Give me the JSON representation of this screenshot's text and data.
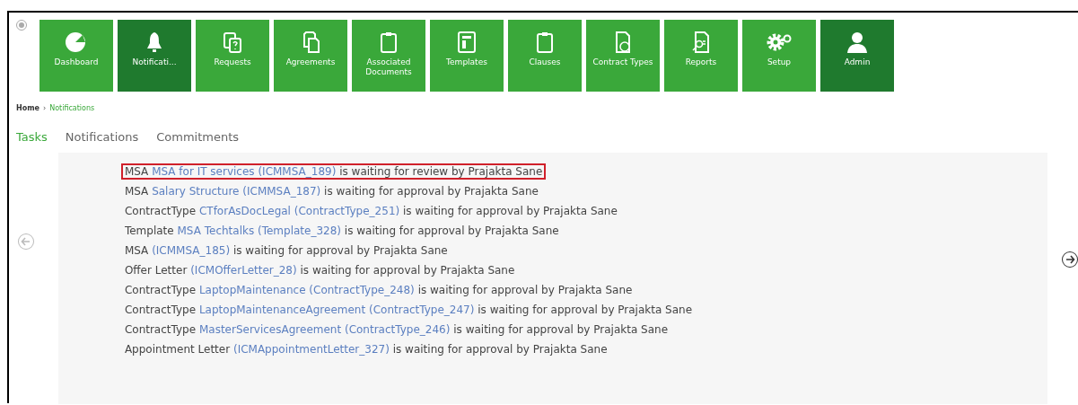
{
  "tiles": [
    {
      "label": "Dashboard",
      "kind": "module",
      "selected": false
    },
    {
      "label": "Notificati...",
      "kind": "module",
      "selected": true
    },
    {
      "label": "Requests",
      "kind": "module",
      "selected": false
    },
    {
      "label": "Agreements",
      "kind": "module",
      "selected": false
    },
    {
      "label": "Associated Documents",
      "kind": "module",
      "selected": false
    },
    {
      "label": "Templates",
      "kind": "module",
      "selected": false
    },
    {
      "label": "Clauses",
      "kind": "module",
      "selected": false
    },
    {
      "label": "Contract Types",
      "kind": "module",
      "selected": false
    },
    {
      "label": "Reports",
      "kind": "module",
      "selected": false
    },
    {
      "label": "Setup",
      "kind": "module",
      "selected": false
    },
    {
      "label": "Admin",
      "kind": "admin"
    }
  ],
  "breadcrumb": {
    "home": "Home",
    "separator": "›",
    "current": "Notifications"
  },
  "tabs": [
    {
      "label": "Tasks",
      "selected": true
    },
    {
      "label": "Notifications",
      "selected": false
    },
    {
      "label": "Commitments",
      "selected": false
    }
  ],
  "prev_arrow": {
    "disabled": true
  },
  "next_arrow": {
    "disabled": false
  },
  "tasks": [
    {
      "type": "MSA",
      "link": "MSA for IT services (ICMMSA_189)",
      "rest": "is waiting for review by Prajakta Sane",
      "highlighted": true
    },
    {
      "type": "MSA",
      "link": "Salary Structure (ICMMSA_187)",
      "rest": "is waiting for approval by Prajakta Sane",
      "highlighted": false
    },
    {
      "type": "ContractType",
      "link": "CTforAsDocLegal (ContractType_251)",
      "rest": "is waiting for approval by Prajakta Sane",
      "highlighted": false
    },
    {
      "type": "Template",
      "link": "MSA Techtalks (Template_328)",
      "rest": "is waiting for approval by Prajakta Sane",
      "highlighted": false
    },
    {
      "type": "MSA",
      "link": "(ICMMSA_185)",
      "rest": "is waiting for approval by Prajakta Sane",
      "highlighted": false
    },
    {
      "type": "Offer Letter",
      "link": "(ICMOfferLetter_28)",
      "rest": "is waiting for approval by Prajakta Sane",
      "highlighted": false
    },
    {
      "type": "ContractType",
      "link": "LaptopMaintenance (ContractType_248)",
      "rest": "is waiting for approval by Prajakta Sane",
      "highlighted": false
    },
    {
      "type": "ContractType",
      "link": "LaptopMaintenanceAgreement (ContractType_247)",
      "rest": "is waiting for approval by Prajakta Sane",
      "highlighted": false
    },
    {
      "type": "ContractType",
      "link": "MasterServicesAgreement (ContractType_246)",
      "rest": "is waiting for approval by Prajakta Sane",
      "highlighted": false
    },
    {
      "type": "Appointment Letter",
      "link": "(ICMAppointmentLetter_327)",
      "rest": "is waiting for approval by Prajakta Sane",
      "highlighted": false
    }
  ]
}
